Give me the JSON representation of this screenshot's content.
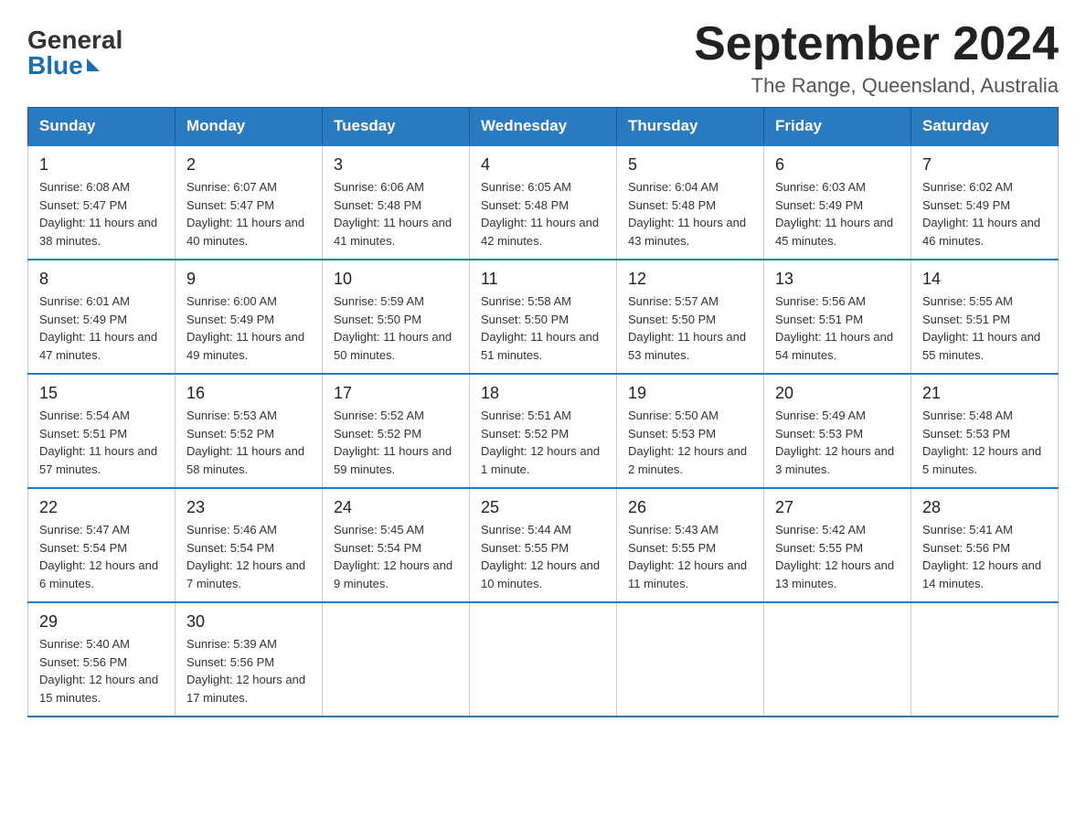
{
  "header": {
    "logo_general": "General",
    "logo_blue": "Blue",
    "month_title": "September 2024",
    "location": "The Range, Queensland, Australia"
  },
  "days_of_week": [
    "Sunday",
    "Monday",
    "Tuesday",
    "Wednesday",
    "Thursday",
    "Friday",
    "Saturday"
  ],
  "weeks": [
    [
      {
        "day": "1",
        "sunrise": "6:08 AM",
        "sunset": "5:47 PM",
        "daylight": "11 hours and 38 minutes."
      },
      {
        "day": "2",
        "sunrise": "6:07 AM",
        "sunset": "5:47 PM",
        "daylight": "11 hours and 40 minutes."
      },
      {
        "day": "3",
        "sunrise": "6:06 AM",
        "sunset": "5:48 PM",
        "daylight": "11 hours and 41 minutes."
      },
      {
        "day": "4",
        "sunrise": "6:05 AM",
        "sunset": "5:48 PM",
        "daylight": "11 hours and 42 minutes."
      },
      {
        "day": "5",
        "sunrise": "6:04 AM",
        "sunset": "5:48 PM",
        "daylight": "11 hours and 43 minutes."
      },
      {
        "day": "6",
        "sunrise": "6:03 AM",
        "sunset": "5:49 PM",
        "daylight": "11 hours and 45 minutes."
      },
      {
        "day": "7",
        "sunrise": "6:02 AM",
        "sunset": "5:49 PM",
        "daylight": "11 hours and 46 minutes."
      }
    ],
    [
      {
        "day": "8",
        "sunrise": "6:01 AM",
        "sunset": "5:49 PM",
        "daylight": "11 hours and 47 minutes."
      },
      {
        "day": "9",
        "sunrise": "6:00 AM",
        "sunset": "5:49 PM",
        "daylight": "11 hours and 49 minutes."
      },
      {
        "day": "10",
        "sunrise": "5:59 AM",
        "sunset": "5:50 PM",
        "daylight": "11 hours and 50 minutes."
      },
      {
        "day": "11",
        "sunrise": "5:58 AM",
        "sunset": "5:50 PM",
        "daylight": "11 hours and 51 minutes."
      },
      {
        "day": "12",
        "sunrise": "5:57 AM",
        "sunset": "5:50 PM",
        "daylight": "11 hours and 53 minutes."
      },
      {
        "day": "13",
        "sunrise": "5:56 AM",
        "sunset": "5:51 PM",
        "daylight": "11 hours and 54 minutes."
      },
      {
        "day": "14",
        "sunrise": "5:55 AM",
        "sunset": "5:51 PM",
        "daylight": "11 hours and 55 minutes."
      }
    ],
    [
      {
        "day": "15",
        "sunrise": "5:54 AM",
        "sunset": "5:51 PM",
        "daylight": "11 hours and 57 minutes."
      },
      {
        "day": "16",
        "sunrise": "5:53 AM",
        "sunset": "5:52 PM",
        "daylight": "11 hours and 58 minutes."
      },
      {
        "day": "17",
        "sunrise": "5:52 AM",
        "sunset": "5:52 PM",
        "daylight": "11 hours and 59 minutes."
      },
      {
        "day": "18",
        "sunrise": "5:51 AM",
        "sunset": "5:52 PM",
        "daylight": "12 hours and 1 minute."
      },
      {
        "day": "19",
        "sunrise": "5:50 AM",
        "sunset": "5:53 PM",
        "daylight": "12 hours and 2 minutes."
      },
      {
        "day": "20",
        "sunrise": "5:49 AM",
        "sunset": "5:53 PM",
        "daylight": "12 hours and 3 minutes."
      },
      {
        "day": "21",
        "sunrise": "5:48 AM",
        "sunset": "5:53 PM",
        "daylight": "12 hours and 5 minutes."
      }
    ],
    [
      {
        "day": "22",
        "sunrise": "5:47 AM",
        "sunset": "5:54 PM",
        "daylight": "12 hours and 6 minutes."
      },
      {
        "day": "23",
        "sunrise": "5:46 AM",
        "sunset": "5:54 PM",
        "daylight": "12 hours and 7 minutes."
      },
      {
        "day": "24",
        "sunrise": "5:45 AM",
        "sunset": "5:54 PM",
        "daylight": "12 hours and 9 minutes."
      },
      {
        "day": "25",
        "sunrise": "5:44 AM",
        "sunset": "5:55 PM",
        "daylight": "12 hours and 10 minutes."
      },
      {
        "day": "26",
        "sunrise": "5:43 AM",
        "sunset": "5:55 PM",
        "daylight": "12 hours and 11 minutes."
      },
      {
        "day": "27",
        "sunrise": "5:42 AM",
        "sunset": "5:55 PM",
        "daylight": "12 hours and 13 minutes."
      },
      {
        "day": "28",
        "sunrise": "5:41 AM",
        "sunset": "5:56 PM",
        "daylight": "12 hours and 14 minutes."
      }
    ],
    [
      {
        "day": "29",
        "sunrise": "5:40 AM",
        "sunset": "5:56 PM",
        "daylight": "12 hours and 15 minutes."
      },
      {
        "day": "30",
        "sunrise": "5:39 AM",
        "sunset": "5:56 PM",
        "daylight": "12 hours and 17 minutes."
      },
      null,
      null,
      null,
      null,
      null
    ]
  ],
  "labels": {
    "sunrise": "Sunrise:",
    "sunset": "Sunset:",
    "daylight": "Daylight:"
  }
}
